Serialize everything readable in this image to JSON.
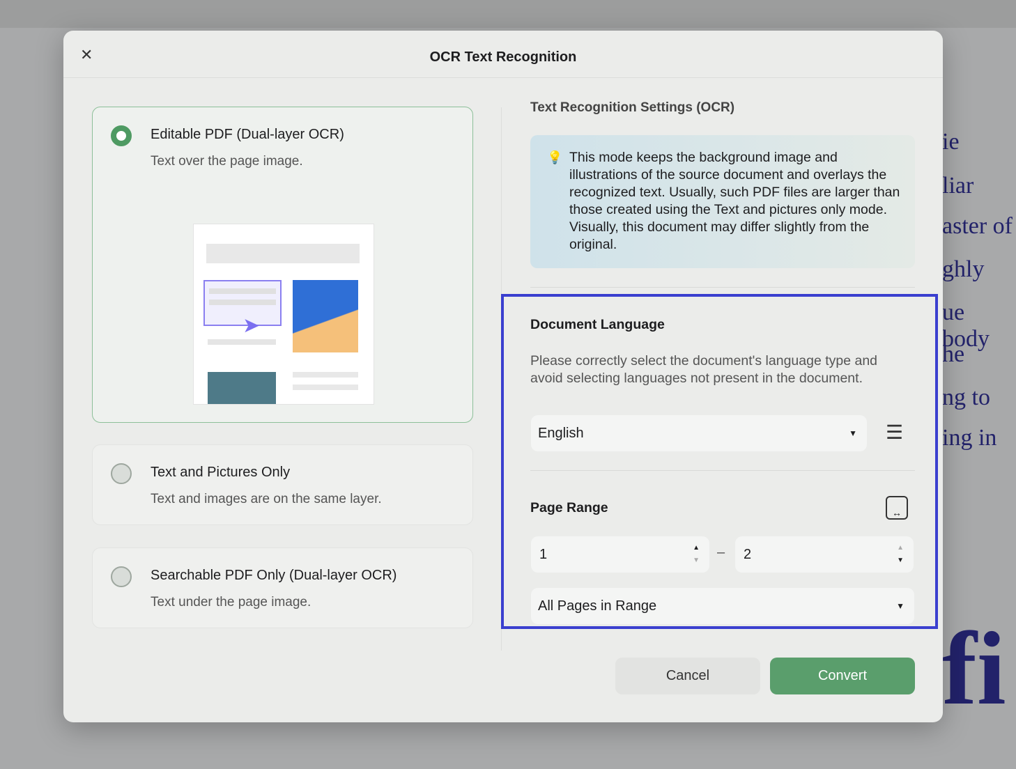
{
  "dialog": {
    "title": "OCR Text Recognition"
  },
  "options": [
    {
      "title": "Editable PDF (Dual-layer OCR)",
      "desc": "Text over the page image.",
      "selected": true
    },
    {
      "title": "Text and Pictures Only",
      "desc": "Text and images are on the same layer.",
      "selected": false
    },
    {
      "title": "Searchable PDF Only (Dual-layer OCR)",
      "desc": "Text under the page image.",
      "selected": false
    }
  ],
  "settings": {
    "section_title": "Text Recognition Settings (OCR)",
    "info": "This mode keeps the background image and illustrations of the source document and overlays the recognized text. Usually, such PDF files are larger than those created using the Text and pictures only mode. Visually, this document may differ slightly from the original."
  },
  "language": {
    "title": "Document Language",
    "desc": "Please correctly select the document's language type and avoid selecting languages not present in the document.",
    "value": "English"
  },
  "page_range": {
    "title": "Page Range",
    "from": "1",
    "dash": "–",
    "to": "2",
    "mode": "All Pages in Range"
  },
  "buttons": {
    "cancel": "Cancel",
    "convert": "Convert"
  },
  "background": {
    "fragments": [
      "ie",
      "liar",
      "aster of",
      "ghly",
      "ue body",
      "he",
      "ng to",
      "ing in",
      "fi"
    ]
  },
  "colors": {
    "accent": "#5a9e6c",
    "highlight": "#3a3fcf"
  }
}
